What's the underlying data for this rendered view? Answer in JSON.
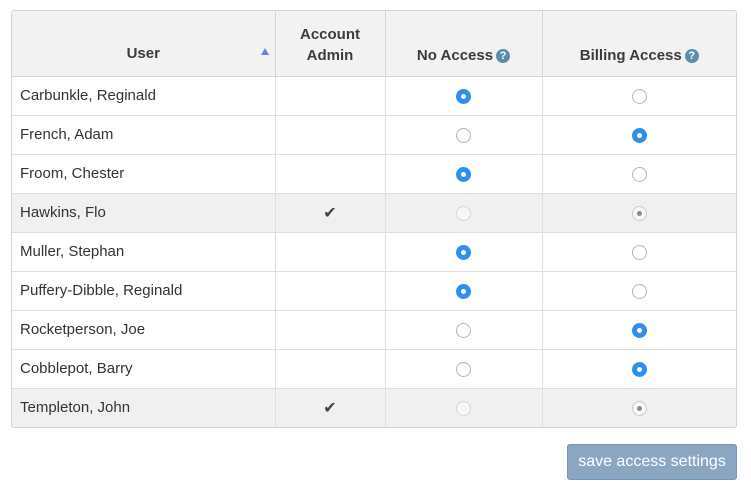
{
  "headers": {
    "user": "User",
    "account_admin_line1": "Account",
    "account_admin_line2": "Admin",
    "no_access": "No Access",
    "billing_access": "Billing Access",
    "help_glyph": "?"
  },
  "users": [
    {
      "name": "Carbunkle, Reginald",
      "admin": false,
      "access": "none"
    },
    {
      "name": "French, Adam",
      "admin": false,
      "access": "billing"
    },
    {
      "name": "Froom, Chester",
      "admin": false,
      "access": "none"
    },
    {
      "name": "Hawkins, Flo",
      "admin": true,
      "access": "billing"
    },
    {
      "name": "Muller, Stephan",
      "admin": false,
      "access": "none"
    },
    {
      "name": "Puffery-Dibble, Reginald",
      "admin": false,
      "access": "none"
    },
    {
      "name": "Rocketperson, Joe",
      "admin": false,
      "access": "billing"
    },
    {
      "name": "Cobblepot, Barry",
      "admin": false,
      "access": "billing"
    },
    {
      "name": "Templeton, John",
      "admin": true,
      "access": "billing"
    }
  ],
  "check_glyph": "✔",
  "save_button_label": "save access settings",
  "colors": {
    "accent": "#2f8fee",
    "button": "#8aa6c1",
    "help": "#5a8fa8"
  }
}
